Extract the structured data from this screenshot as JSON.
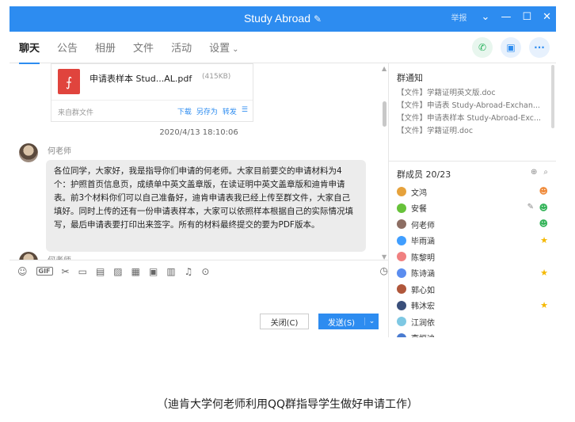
{
  "window": {
    "title": "Study Abroad",
    "mini_label": "举报",
    "accent": "#2d8cf0"
  },
  "tabs": [
    {
      "label": "聊天",
      "active": true
    },
    {
      "label": "公告"
    },
    {
      "label": "相册"
    },
    {
      "label": "文件"
    },
    {
      "label": "活动"
    },
    {
      "label": "设置"
    }
  ],
  "chat": {
    "file": {
      "name": "申请表样本 Stud...AL.pdf",
      "size": "(415KB)",
      "source": "来自群文件",
      "actions": [
        "下载",
        "另存为",
        "转发"
      ]
    },
    "timestamp": "2020/4/13 18:10:06",
    "messages": [
      {
        "sender": "何老师",
        "text": "各位同学，大家好，我是指导你们申请的何老师。大家目前要交的申请材料为4个：护照首页信息页，成绩单中英文盖章版，在读证明中英文盖章版和迪肯申请表。前3个材料你们可以自己准备好，迪肯申请表我已经上传至群文件，大家自己填好。同时上传的还有一份申请表样本，大家可以依照样本根据自己的实际情况填写，最后申请表要打印出来签字。所有的材料最终提交的要为PDF版本。"
      },
      {
        "sender": "何老师"
      }
    ]
  },
  "toolbar": {
    "gif_label": "GIF"
  },
  "input": {
    "close_label": "关闭(C)",
    "send_label": "发送(S)"
  },
  "notice": {
    "title": "群通知",
    "lines": [
      "【文件】学籍证明英文版.doc",
      "【文件】申请表 Study-Abroad-Exchan...",
      "【文件】申请表样本 Study-Abroad-Exc...",
      "【文件】学籍证明.doc"
    ]
  },
  "members": {
    "title": "群成员 20/23",
    "list": [
      {
        "name": "文鸿",
        "color": "#e6a23c",
        "badge": "owner"
      },
      {
        "name": "安餐",
        "color": "#67c23a",
        "badge": "admin"
      },
      {
        "name": "何老师",
        "color": "#8d6e63",
        "badge": "admin"
      },
      {
        "name": "毕雨涵",
        "color": "#409eff",
        "badge": "star"
      },
      {
        "name": "陈黎明",
        "color": "#f08080",
        "badge": ""
      },
      {
        "name": "陈诗涵",
        "color": "#5b8def",
        "badge": "star"
      },
      {
        "name": "郭心如",
        "color": "#b0573b",
        "badge": ""
      },
      {
        "name": "韩沐宏",
        "color": "#3a4f7a",
        "badge": "star"
      },
      {
        "name": "江润依",
        "color": "#7ec8e3",
        "badge": ""
      },
      {
        "name": "李恒迪",
        "color": "#4a7bd0",
        "badge": ""
      }
    ]
  },
  "caption": "（迪肯大学何老师利用QQ群指导学生做好申请工作）"
}
